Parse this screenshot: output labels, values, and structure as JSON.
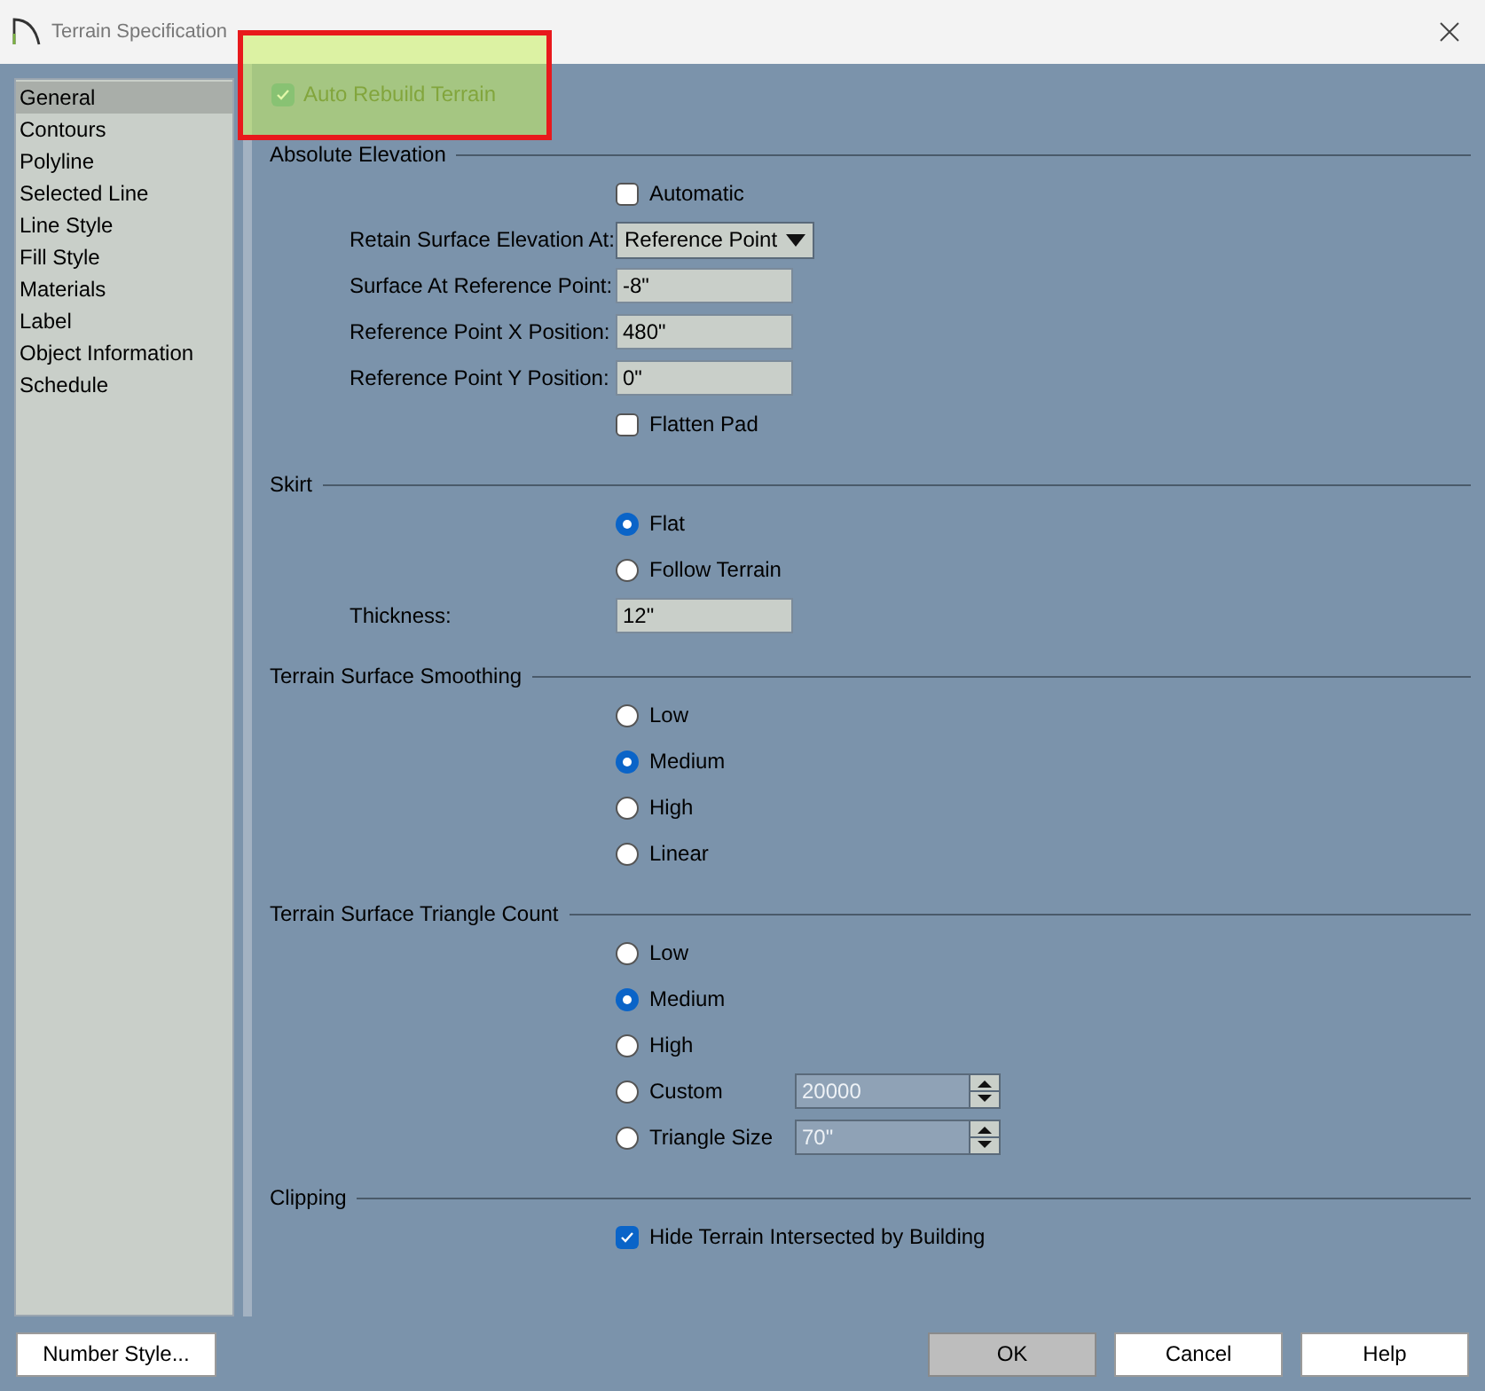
{
  "window": {
    "title": "Terrain Specification"
  },
  "sidebar": {
    "items": [
      {
        "label": "General",
        "selected": true
      },
      {
        "label": "Contours",
        "selected": false
      },
      {
        "label": "Polyline",
        "selected": false
      },
      {
        "label": "Selected Line",
        "selected": false
      },
      {
        "label": "Line Style",
        "selected": false
      },
      {
        "label": "Fill Style",
        "selected": false
      },
      {
        "label": "Materials",
        "selected": false
      },
      {
        "label": "Label",
        "selected": false
      },
      {
        "label": "Object Information",
        "selected": false
      },
      {
        "label": "Schedule",
        "selected": false
      }
    ]
  },
  "auto_rebuild": {
    "label": "Auto Rebuild Terrain",
    "checked": true,
    "highlighted": true
  },
  "sections": [
    {
      "title": "Absolute Elevation",
      "rows": [
        {
          "kind": "checkbox",
          "label": "Automatic",
          "checked": false
        },
        {
          "kind": "dropdown",
          "label": "Retain Surface Elevation At:",
          "value": "Reference Point"
        },
        {
          "kind": "field",
          "label": "Surface At Reference Point:",
          "value": "-8\""
        },
        {
          "kind": "field",
          "label": "Reference Point X Position:",
          "value": "480\""
        },
        {
          "kind": "field",
          "label": "Reference Point Y Position:",
          "value": "0\""
        },
        {
          "kind": "checkbox",
          "label": "Flatten Pad",
          "checked": false
        }
      ]
    },
    {
      "title": "Skirt",
      "rows": [
        {
          "kind": "radio",
          "label": "Flat",
          "selected": true
        },
        {
          "kind": "radio",
          "label": "Follow Terrain",
          "selected": false
        },
        {
          "kind": "field",
          "label": "Thickness:",
          "value": "12\""
        }
      ]
    },
    {
      "title": "Terrain Surface Smoothing",
      "rows": [
        {
          "kind": "radio",
          "label": "Low",
          "selected": false
        },
        {
          "kind": "radio",
          "label": "Medium",
          "selected": true
        },
        {
          "kind": "radio",
          "label": "High",
          "selected": false
        },
        {
          "kind": "radio",
          "label": "Linear",
          "selected": false
        }
      ]
    },
    {
      "title": "Terrain Surface Triangle Count",
      "rows": [
        {
          "kind": "radio",
          "label": "Low",
          "selected": false
        },
        {
          "kind": "radio",
          "label": "Medium",
          "selected": true
        },
        {
          "kind": "radio",
          "label": "High",
          "selected": false
        },
        {
          "kind": "radio",
          "label": "Custom",
          "selected": false,
          "spinner": {
            "value": "20000",
            "disabled": true
          }
        },
        {
          "kind": "radio",
          "label": "Triangle Size",
          "selected": false,
          "spinner": {
            "value": "70\"",
            "disabled": true
          }
        }
      ]
    },
    {
      "title": "Clipping",
      "rows": [
        {
          "kind": "checkbox",
          "label": "Hide Terrain Intersected by Building",
          "checked": true
        }
      ]
    }
  ],
  "buttons": [
    {
      "label": "Number Style...",
      "default": false
    },
    {
      "label": "OK",
      "default": true
    },
    {
      "label": "Cancel",
      "default": false
    },
    {
      "label": "Help",
      "default": false
    }
  ]
}
